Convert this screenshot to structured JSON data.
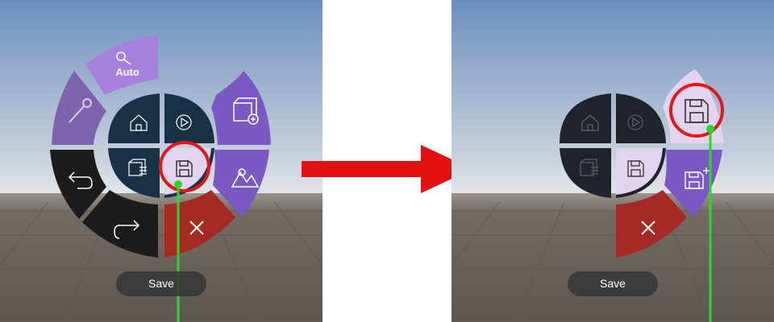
{
  "colors": {
    "sky_top": "#6d8fc0",
    "sky_bottom": "#dde3e8",
    "ground": "#6a625b",
    "purple": "#7b58c4",
    "purple_dim": "#7f62ae",
    "purple_light": "#a77fdd",
    "dark_teal": "#173247",
    "dark_gray": "#1f232b",
    "black": "#1c1c1c",
    "red_item": "#a52a24",
    "highlight": "#e2d3ee",
    "annotation_red": "#e21818",
    "pointer_green": "#22dd22"
  },
  "before": {
    "auto_label": "Auto",
    "tooltip": "Save",
    "icons": [
      "zoom-auto-icon",
      "wrench-icon",
      "undo-icon",
      "redo-icon",
      "close-icon",
      "landscape-icon",
      "add-cube-icon",
      "home-icon",
      "play-icon",
      "layers-icon",
      "save-icon"
    ]
  },
  "after": {
    "tooltip": "Save",
    "icons": [
      "home-icon",
      "play-icon",
      "layers-icon",
      "save-icon",
      "save-icon",
      "save-as-icon",
      "close-icon"
    ]
  }
}
